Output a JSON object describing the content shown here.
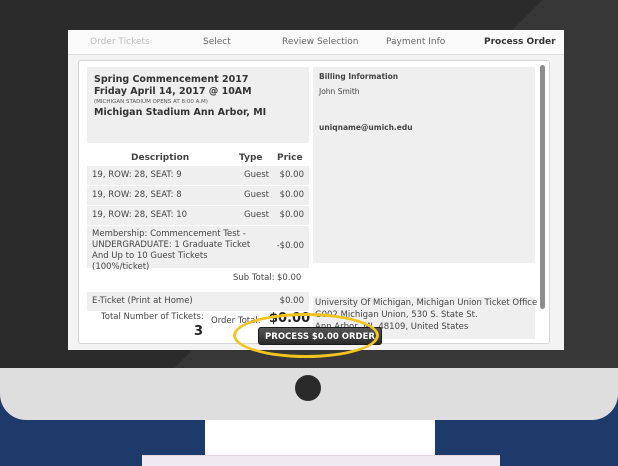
{
  "steps": [
    {
      "label": "Order Tickets"
    },
    {
      "label": "Select"
    },
    {
      "label": "Review Selection"
    },
    {
      "label": "Payment Info"
    },
    {
      "label": "Process Order"
    }
  ],
  "event": {
    "title": "Spring Commencement 2017",
    "date": "Friday April 14, 2017 @ 10AM",
    "note": "(MICHIGAN STADIUM OPENS AT 8:00 A.M)",
    "venue": "Michigan Stadium Ann Arbor, MI"
  },
  "table": {
    "headers": {
      "description": "Description",
      "type": "Type",
      "price": "Price"
    },
    "rows": [
      {
        "description": "19, ROW: 28, SEAT: 9",
        "type": "Guest",
        "price": "$0.00"
      },
      {
        "description": "19, ROW: 28, SEAT: 8",
        "type": "Guest",
        "price": "$0.00"
      },
      {
        "description": "19, ROW: 28, SEAT: 10",
        "type": "Guest",
        "price": "$0.00"
      },
      {
        "description": "Membership: Commencement Test - UNDERGRADUATE: 1 Graduate Ticket And Up to 10 Guest Tickets (100%/ticket)",
        "type": "",
        "price": "-$0.00"
      }
    ],
    "subtotal_label": "Sub Total:",
    "subtotal_value": "$0.00",
    "eticket": {
      "description": "E-Ticket (Print at Home)",
      "price": "$0.00"
    }
  },
  "summary": {
    "total_tickets_label": "Total Number of Tickets:",
    "total_tickets_value": "3",
    "order_total_label": "Order Total:",
    "order_total_value": "$0.00"
  },
  "billing": {
    "title": "Billing Information",
    "name": "John Smith",
    "email": "uniqname@umich.edu"
  },
  "address": {
    "line1": "University Of Michigan, Michigan Union Ticket Office",
    "line2": "G002 Michigan Union, 530 S. State St.",
    "line3": "Ann Arbor, MI, 48109, United States"
  },
  "process_button": {
    "label": "PROCESS $0.00 ORDER"
  },
  "colors": {
    "background": "#1e3a6b",
    "highlight": "#f2c41f",
    "bezel": "#2b2b2b"
  }
}
